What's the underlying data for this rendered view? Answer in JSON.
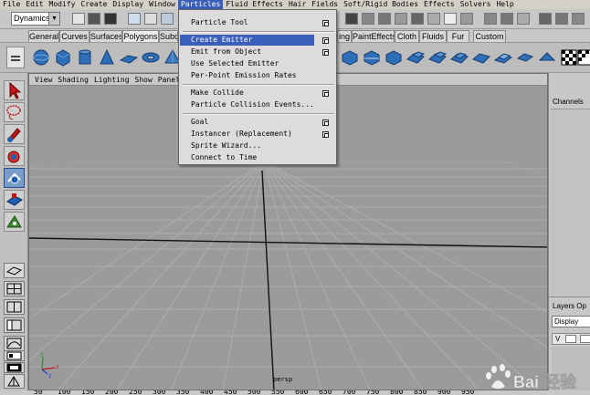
{
  "menubar": {
    "items": [
      "File",
      "Edit",
      "Modify",
      "Create",
      "Display",
      "Window",
      "Particles",
      "Fluid Effects",
      "Hair",
      "Fields",
      "Soft/Rigid Bodies",
      "Effects",
      "Solvers",
      "Help"
    ],
    "active": "Particles"
  },
  "statusline": {
    "mode": "Dynamics"
  },
  "shelf": {
    "tabs": [
      "General",
      "Curves",
      "Surfaces",
      "Polygons",
      "Subd",
      "Rendering",
      "PaintEffects",
      "Cloth",
      "Fluids",
      "Fur",
      "Custom"
    ],
    "visible_tabs": [
      "General",
      "Curves",
      "Surfaces",
      "Polygons",
      "Subc",
      "ing",
      "PaintEffects",
      "Cloth",
      "Fluids",
      "Fur",
      "Custom"
    ],
    "active_tab": "Polygons"
  },
  "particles_menu": {
    "items": [
      {
        "label": "Particle Tool",
        "option": true
      },
      {
        "label": "Create Emitter",
        "option": true,
        "highlighted": true
      },
      {
        "label": "Emit from Object",
        "option": true
      },
      {
        "label": "Use Selected Emitter",
        "option": false
      },
      {
        "label": "Per-Point Emission Rates",
        "option": false
      },
      {
        "label": "Make Collide",
        "option": true
      },
      {
        "label": "Particle Collision Events...",
        "option": false
      },
      {
        "label": "Goal",
        "option": true
      },
      {
        "label": "Instancer (Replacement)",
        "option": true
      },
      {
        "label": "Sprite Wizard...",
        "option": false
      },
      {
        "label": "Connect to Time",
        "option": false
      }
    ]
  },
  "viewport": {
    "menu": [
      "View",
      "Shading",
      "Lighting",
      "Show",
      "Panels"
    ],
    "camera_label": "persp"
  },
  "channel_box": {
    "label": "Channels"
  },
  "layer_editor": {
    "label": "Layers  Op",
    "display_select": "Display",
    "row_visibility": "V"
  },
  "time_slider": {
    "ticks": [
      "50",
      "100",
      "150",
      "200",
      "250",
      "300",
      "350",
      "400",
      "450",
      "500",
      "550",
      "600",
      "650",
      "700",
      "750",
      "800",
      "850",
      "900",
      "950"
    ]
  },
  "watermark": {
    "text": "Bai 经验"
  },
  "colors": {
    "highlight": "#3a5fb8",
    "viewport_bg": "#9b9b9b",
    "ui_gray": "#c8c8c8"
  }
}
